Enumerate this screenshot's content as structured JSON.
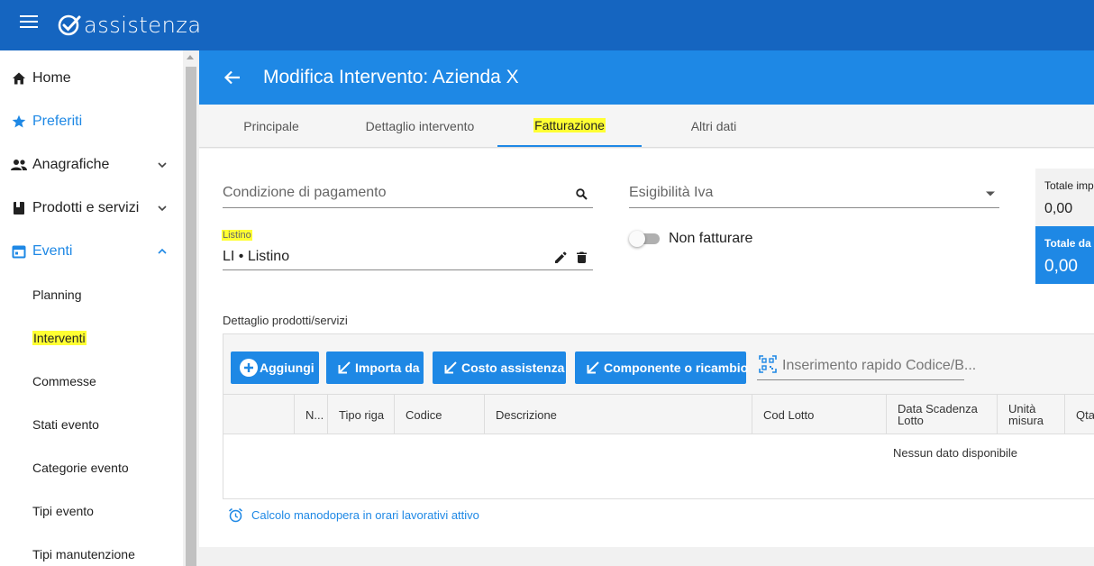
{
  "app": {
    "logo_text": "assistenza"
  },
  "sidebar": {
    "items": [
      {
        "label": "Home",
        "icon": "home-icon"
      },
      {
        "label": "Preferiti",
        "icon": "star-icon"
      },
      {
        "label": "Anagrafiche",
        "icon": "people-icon"
      },
      {
        "label": "Prodotti e servizi",
        "icon": "book-icon"
      },
      {
        "label": "Eventi",
        "icon": "calendar-icon"
      }
    ],
    "sub_items": [
      {
        "label": "Planning"
      },
      {
        "label": "Interventi"
      },
      {
        "label": "Commesse"
      },
      {
        "label": "Stati evento"
      },
      {
        "label": "Categorie evento"
      },
      {
        "label": "Tipi evento"
      },
      {
        "label": "Tipi manutenzione"
      }
    ]
  },
  "header": {
    "title": "Modifica Intervento: Azienda X"
  },
  "tabs": [
    {
      "label": "Principale"
    },
    {
      "label": "Dettaglio intervento"
    },
    {
      "label": "Fatturazione"
    },
    {
      "label": "Altri dati"
    }
  ],
  "form": {
    "payment_placeholder": "Condizione di pagamento",
    "vat_placeholder": "Esigibilità Iva",
    "listino_label": "Listino",
    "listino_value": "LI • Listino",
    "no_invoice_label": "Non fatturare"
  },
  "totals": {
    "total_imp_label": "Totale imp",
    "total_imp_value": "0,00",
    "total_da_label": "Totale da p",
    "total_da_value": "0,00"
  },
  "detail": {
    "section_label": "Dettaglio prodotti/servizi",
    "buttons": {
      "add": "Aggiungi",
      "import": "Importa da",
      "cost": "Costo assistenza",
      "component": "Componente o ricambio"
    },
    "quick_input_placeholder": "Inserimento rapido Codice/B...",
    "columns": [
      "N...",
      "Tipo riga",
      "Codice",
      "Descrizione",
      "Cod Lotto",
      "Data Scadenza Lotto",
      "Unità misura",
      "Qta"
    ],
    "empty_message": "Nessun dato disponibile"
  },
  "footer_note": "Calcolo manodopera in orari lavorativi attivo",
  "colors": {
    "brand_dark": "#1565c0",
    "brand": "#1e88e5",
    "highlight": "#ffff33"
  }
}
